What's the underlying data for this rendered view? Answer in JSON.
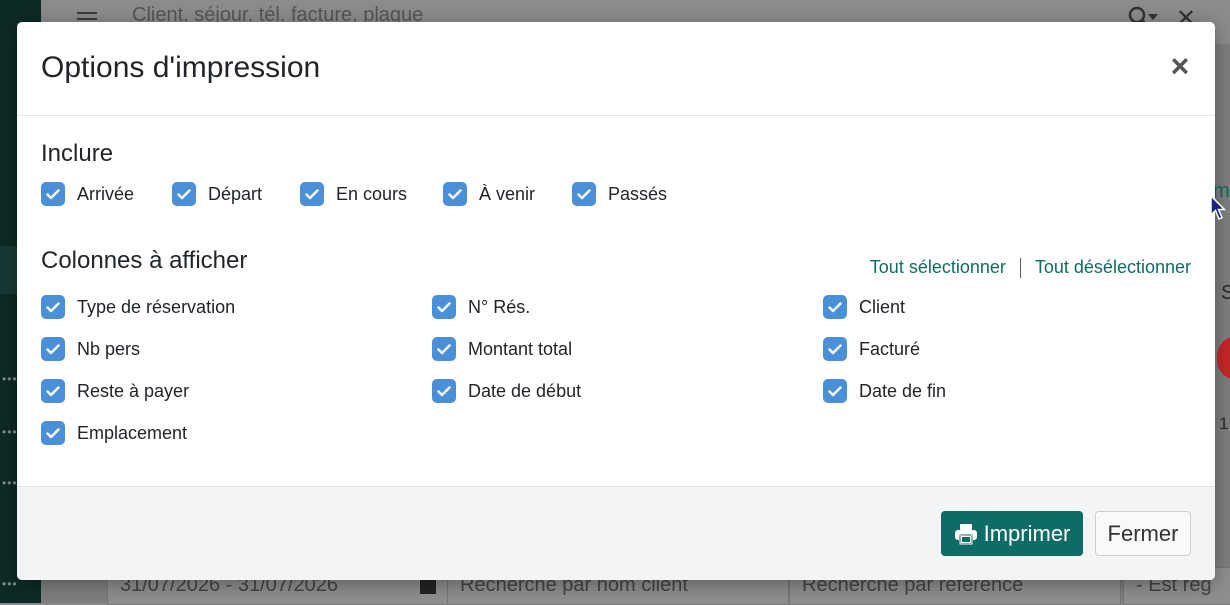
{
  "background": {
    "search_placeholder": "Client, séjour, tél, facture, plaque",
    "filters": {
      "date_range": "31/07/2026 - 31/07/2026",
      "client_search_placeholder": "Recherche par nom client",
      "reference_search_placeholder": "Recherche par référence",
      "status": "- Est rég"
    },
    "right_fragments": [
      "m",
      "S",
      "1"
    ],
    "accent_color": "#c62828"
  },
  "modal": {
    "title": "Options d'impression",
    "close_label": "×",
    "include": {
      "title": "Inclure",
      "options": [
        {
          "label": "Arrivée",
          "checked": true
        },
        {
          "label": "Départ",
          "checked": true
        },
        {
          "label": "En cours",
          "checked": true
        },
        {
          "label": "À venir",
          "checked": true
        },
        {
          "label": "Passés",
          "checked": true
        }
      ]
    },
    "columns": {
      "title": "Colonnes à afficher",
      "select_all": "Tout sélectionner",
      "deselect_all": "Tout désélectionner",
      "items": [
        {
          "label": "Type de réservation",
          "checked": true
        },
        {
          "label": "N° Rés.",
          "checked": true
        },
        {
          "label": "Client",
          "checked": true
        },
        {
          "label": "Nb pers",
          "checked": true
        },
        {
          "label": "Montant total",
          "checked": true
        },
        {
          "label": "Facturé",
          "checked": true
        },
        {
          "label": "Reste à payer",
          "checked": true
        },
        {
          "label": "Date de début",
          "checked": true
        },
        {
          "label": "Date de fin",
          "checked": true
        },
        {
          "label": "Emplacement",
          "checked": true
        }
      ]
    },
    "footer": {
      "print_label": "Imprimer",
      "close_label": "Fermer"
    }
  },
  "colors": {
    "primary": "#0e6b66",
    "checkbox": "#4a90d9",
    "link": "#0f6b66"
  }
}
